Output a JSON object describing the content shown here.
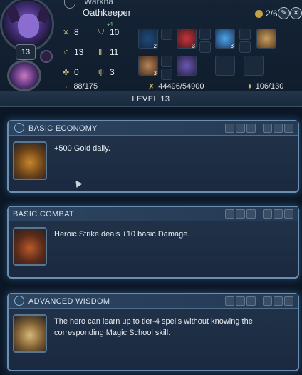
{
  "hero": {
    "name_partial": "Warkna",
    "name": "Oathkeeper",
    "level": "13",
    "army_count": "2/6"
  },
  "stats": {
    "attack": "8",
    "defense": "10",
    "defense_bonus": "+1",
    "spellpower": "13",
    "knowledge": "11",
    "luck": "0",
    "morale": "3"
  },
  "slots": {
    "s1": "2",
    "s2": "3",
    "s3": "3",
    "s4": "3"
  },
  "bottom": {
    "movement": "88/175",
    "experience": "44496/54900",
    "mana": "106/130"
  },
  "level_header": "LEVEL 13",
  "cards": [
    {
      "title": "BASIC ECONOMY",
      "desc": "+500 Gold daily."
    },
    {
      "title": "BASIC COMBAT",
      "desc": "Heroic Strike deals +10 basic Damage."
    },
    {
      "title": "ADVANCED WISDOM",
      "desc": "The hero can learn up to tier-4 spells without knowing the corresponding Magic School skill."
    }
  ],
  "icons": {
    "info": "info-icon",
    "close": "close-icon",
    "tip": "lightbulb-icon"
  },
  "colors": {
    "background": "#0b1726",
    "card_border": "#6a8fb0",
    "accent_gold": "#c9b26b",
    "bonus_green": "#6fd16f"
  }
}
